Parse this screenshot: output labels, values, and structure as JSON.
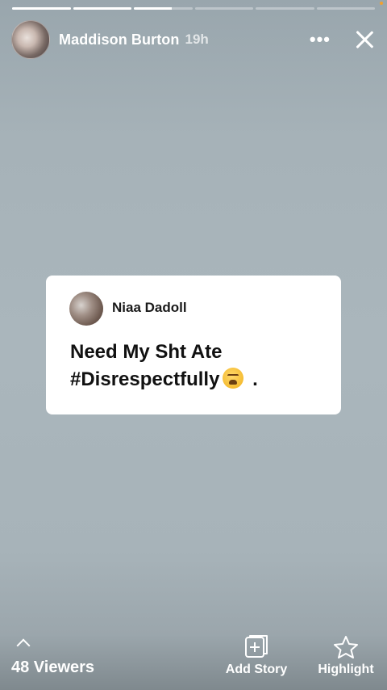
{
  "story": {
    "segments": [
      {
        "progress": 1.0
      },
      {
        "progress": 1.0
      },
      {
        "progress": 0.65
      },
      {
        "progress": 0.0
      },
      {
        "progress": 0.0
      },
      {
        "progress": 0.0
      }
    ]
  },
  "header": {
    "username": "Maddison Burton",
    "time_ago": "19h",
    "more_label": "•••"
  },
  "card": {
    "author": "Niaa Dadoll",
    "text_line1": "Need My Sht Ate",
    "text_line2": "#Disrespectfully",
    "text_suffix": "."
  },
  "footer": {
    "viewers_label": "48 Viewers",
    "add_story_label": "Add Story",
    "highlight_label": "Highlight"
  },
  "colors": {
    "accent_dot": "#f0a030",
    "card_background": "#ffffff"
  }
}
